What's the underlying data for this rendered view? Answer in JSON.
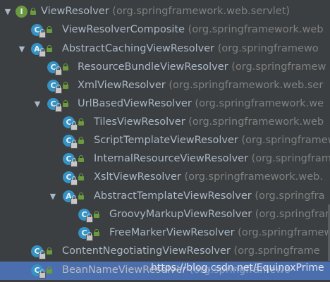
{
  "tree": {
    "rows": [
      {
        "name": "ViewResolver",
        "package": "(org.springframework.web.servlet)",
        "expanded": true,
        "icon": "interface-icon"
      },
      {
        "name": "ViewResolverComposite",
        "package": "(org.springframework.web",
        "icon": "class-icon"
      },
      {
        "name": "AbstractCachingViewResolver",
        "package": "(org.springframewo",
        "expanded": true,
        "icon": "abstract-class-icon"
      },
      {
        "name": "ResourceBundleViewResolver",
        "package": "(org.springframew",
        "icon": "class-icon"
      },
      {
        "name": "XmlViewResolver",
        "package": "(org.springframework.web.ser",
        "icon": "class-icon"
      },
      {
        "name": "UrlBasedViewResolver",
        "package": "(org.springframework.we",
        "expanded": true,
        "icon": "class-icon"
      },
      {
        "name": "TilesViewResolver",
        "package": "(org.springframework.web",
        "icon": "class-icon"
      },
      {
        "name": "ScriptTemplateViewResolver",
        "package": "(org.springframew",
        "icon": "class-icon"
      },
      {
        "name": "InternalResourceViewResolver",
        "package": "(org.springfram",
        "icon": "class-icon"
      },
      {
        "name": "XsltViewResolver",
        "package": "(org.springframework.web.",
        "icon": "class-icon"
      },
      {
        "name": "AbstractTemplateViewResolver",
        "package": "(org.springfra",
        "expanded": true,
        "icon": "abstract-class-icon"
      },
      {
        "name": "GroovyMarkupViewResolver",
        "package": "(org.springframe",
        "icon": "class-icon"
      },
      {
        "name": "FreeMarkerViewResolver",
        "package": "(org.springframewo",
        "icon": "class-icon"
      },
      {
        "name": "ContentNegotiatingViewResolver",
        "package": "(org.springframe",
        "icon": "class-icon"
      },
      {
        "name": "BeanNameViewResolver",
        "package": "(org.springframewo",
        "icon": "class-icon",
        "selected": true
      }
    ]
  },
  "watermark": "https://blog.csdn.net/EquinoxPrime",
  "colors": {
    "background": "#3c3f41",
    "selection": "#4b6eaf",
    "class_name": "#a9b7c6",
    "package_name": "#808080",
    "class_icon": "#3592c4",
    "visibility_icon": "#6a9c3c"
  }
}
